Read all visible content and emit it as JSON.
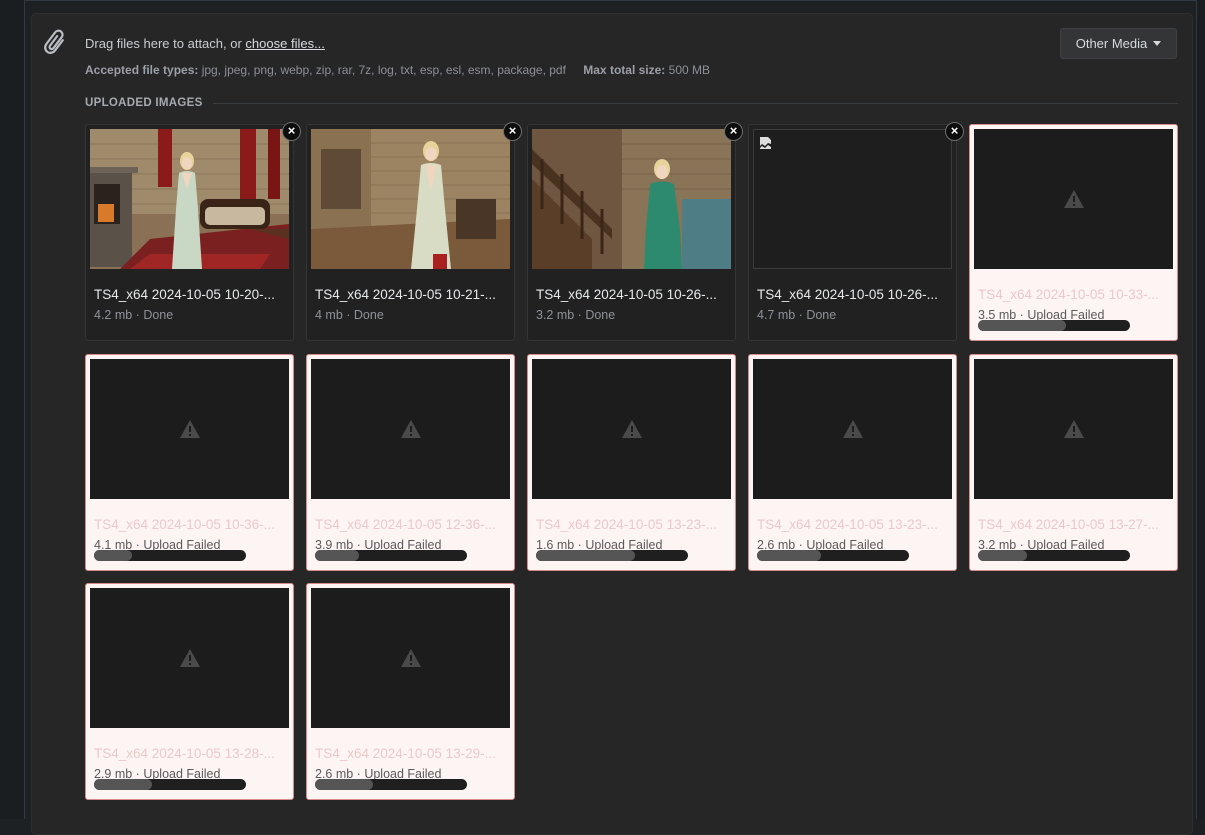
{
  "attach": {
    "drag_text": "Drag files here to attach, or ",
    "choose_link": "choose files...",
    "types_label": "Accepted file types:",
    "types_value": "jpg, jpeg, png, webp, zip, rar, 7z, log, txt, esp, esl, esm, package, pdf",
    "max_label": "Max total size:",
    "max_value": "500 MB",
    "other_media_label": "Other Media"
  },
  "section": {
    "title": "UPLOADED IMAGES"
  },
  "icons": {
    "attach": "paperclip-icon",
    "remove": "close-icon",
    "warning": "warning-triangle-icon",
    "broken": "broken-image-icon",
    "dropdown": "caret-down-icon"
  },
  "colors": {
    "failed_bg": "#fdf4f4",
    "failed_border": "#d98a8a",
    "panel_bg": "#262626"
  },
  "uploads": [
    {
      "name": "TS4_x64 2024-10-05 10-20-...",
      "meta": "4.2 mb · Done",
      "status": "done"
    },
    {
      "name": "TS4_x64 2024-10-05 10-21-...",
      "meta": "4 mb · Done",
      "status": "done"
    },
    {
      "name": "TS4_x64 2024-10-05 10-26-...",
      "meta": "3.2 mb · Done",
      "status": "done"
    },
    {
      "name": "TS4_x64 2024-10-05 10-26-...",
      "meta": "4.7 mb · Done",
      "status": "done"
    },
    {
      "name": "TS4_x64 2024-10-05 10-33-...",
      "meta": "3.5 mb · Upload Failed",
      "status": "failed",
      "progress": 0.58
    },
    {
      "name": "TS4_x64 2024-10-05 10-36-...",
      "meta": "4.1 mb · Upload Failed",
      "status": "failed",
      "progress": 0.25
    },
    {
      "name": "TS4_x64 2024-10-05 12-36-...",
      "meta": "3.9 mb · Upload Failed",
      "status": "failed",
      "progress": 0.29
    },
    {
      "name": "TS4_x64 2024-10-05 13-23-...",
      "meta": "1.6 mb · Upload Failed",
      "status": "failed",
      "progress": 0.65
    },
    {
      "name": "TS4_x64 2024-10-05 13-23-...",
      "meta": "2.6 mb · Upload Failed",
      "status": "failed",
      "progress": 0.42
    },
    {
      "name": "TS4_x64 2024-10-05 13-27-...",
      "meta": "3.2 mb · Upload Failed",
      "status": "failed",
      "progress": 0.32
    },
    {
      "name": "TS4_x64 2024-10-05 13-28-...",
      "meta": "2.9 mb · Upload Failed",
      "status": "failed",
      "progress": 0.38
    },
    {
      "name": "TS4_x64 2024-10-05 13-29-...",
      "meta": "2.6 mb · Upload Failed",
      "status": "failed",
      "progress": 0.38
    }
  ]
}
